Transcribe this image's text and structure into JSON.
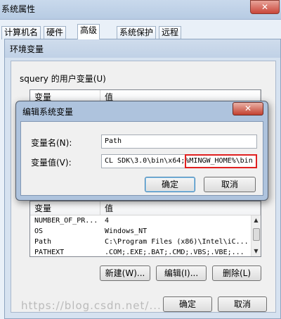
{
  "system_properties": {
    "title": "系统属性",
    "close_glyph": "✕",
    "tabs": [
      "计算机名",
      "硬件",
      "高级",
      "系统保护",
      "远程"
    ],
    "active_tab": "高级"
  },
  "env_window": {
    "title": "环境变量",
    "user_group_label": "squery 的用户变量(U)",
    "user_list": {
      "columns": [
        "变量",
        "值"
      ]
    },
    "system_list": {
      "columns": [
        "变量",
        "值"
      ],
      "rows": [
        {
          "name": "NUMBER_OF_PR...",
          "value": "4"
        },
        {
          "name": "OS",
          "value": "Windows_NT"
        },
        {
          "name": "Path",
          "value": "C:\\Program Files (x86)\\Intel\\iC..."
        },
        {
          "name": "PATHEXT",
          "value": ".COM;.EXE;.BAT;.CMD;.VBS;.VBE;..."
        }
      ]
    },
    "buttons": {
      "new": "新建(W)...",
      "edit": "编辑(I)...",
      "delete": "删除(L)",
      "ok": "确定",
      "cancel": "取消"
    }
  },
  "edit_dialog": {
    "title": "编辑系统变量",
    "close_glyph": "✕",
    "name_label": "变量名(N):",
    "name_value": "Path",
    "value_label": "变量值(V):",
    "value_text": "CL SDK\\3.0\\bin\\x64;",
    "value_highlight": "%MINGW_HOME%\\bin",
    "ok": "确定",
    "cancel": "取消"
  },
  "watermark": "https://blog.csdn.net/..."
}
